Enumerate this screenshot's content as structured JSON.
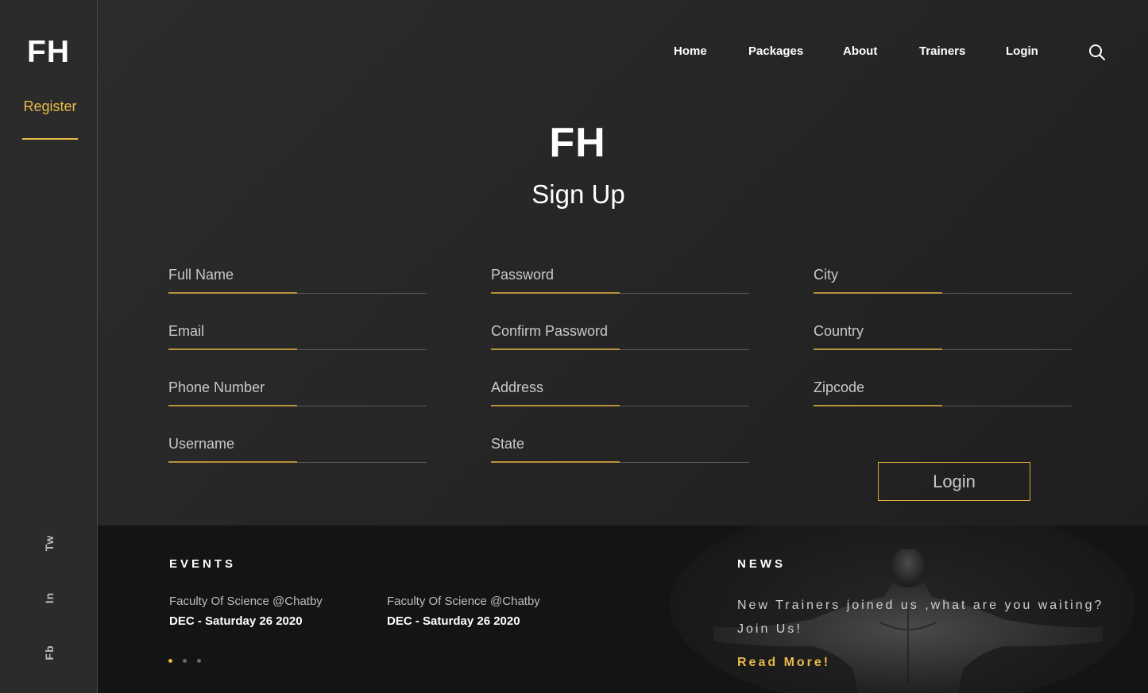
{
  "sidebar": {
    "logo": "FH",
    "register_label": "Register",
    "social": [
      "Tw",
      "In",
      "Fb"
    ]
  },
  "nav": {
    "items": [
      "Home",
      "Packages",
      "About",
      "Trainers",
      "Login"
    ],
    "search_icon": "search-icon"
  },
  "header": {
    "brand": "FH",
    "title": "Sign Up"
  },
  "form": {
    "fields": [
      "Full Name",
      "Email",
      "Phone Number",
      "Username",
      "Password",
      "Confirm Password",
      "Address",
      "State",
      "City",
      "Country",
      "Zipcode"
    ],
    "submit_label": "Login"
  },
  "footer": {
    "events": {
      "heading": "EVENTS",
      "items": [
        {
          "place": "Faculty Of Science @Chatby",
          "date": "DEC - Saturday 26 2020"
        },
        {
          "place": "Faculty Of Science @Chatby",
          "date": "DEC - Saturday 26 2020"
        }
      ],
      "carousel_total": 3,
      "carousel_active": 1
    },
    "news": {
      "heading": "NEWS",
      "text": "New Trainers joined us ,what are you waiting? Join Us!",
      "read_more": "Read More!"
    }
  },
  "colors": {
    "accent": "#e9b949",
    "background": "#262626",
    "footer": "#141414"
  }
}
